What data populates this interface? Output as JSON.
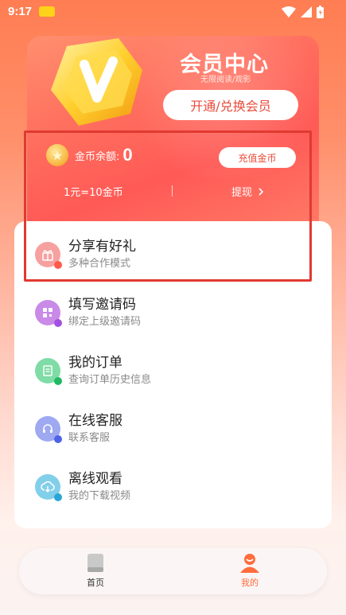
{
  "status_bar": {
    "time": "9:17"
  },
  "member": {
    "title": "会员中心",
    "subtitle": "无限阅读/观影",
    "open_button": "开通/兑换会员",
    "coin_label": "金币余额:",
    "coin_amount": "0",
    "recharge_button": "充值金币",
    "rate": "1元=10金币",
    "withdraw": "提现"
  },
  "menu": [
    {
      "label": "分享有好礼",
      "desc": "多种合作模式",
      "icon": "gift-icon",
      "color": "#f58a8a",
      "dot": "#ff5a4a"
    },
    {
      "label": "填写邀请码",
      "desc": "绑定上级邀请码",
      "icon": "qrcode-icon",
      "color": "#c27be6",
      "dot": "#a34fe0"
    },
    {
      "label": "我的订单",
      "desc": "查询订单历史信息",
      "icon": "order-icon",
      "color": "#6ad89a",
      "dot": "#20b860"
    },
    {
      "label": "在线客服",
      "desc": "联系客服",
      "icon": "headset-icon",
      "color": "#8f9cf0",
      "dot": "#4f63e6"
    },
    {
      "label": "离线观看",
      "desc": "我的下载视频",
      "icon": "cloud-download-icon",
      "color": "#6fc6e6",
      "dot": "#2aa6d8"
    }
  ],
  "nav": [
    {
      "label": "首页",
      "icon": "book-icon",
      "active": false
    },
    {
      "label": "我的",
      "icon": "profile-icon",
      "active": true
    }
  ],
  "colors": {
    "accent": "#ff6d3d",
    "highlight": "#e03a30"
  }
}
